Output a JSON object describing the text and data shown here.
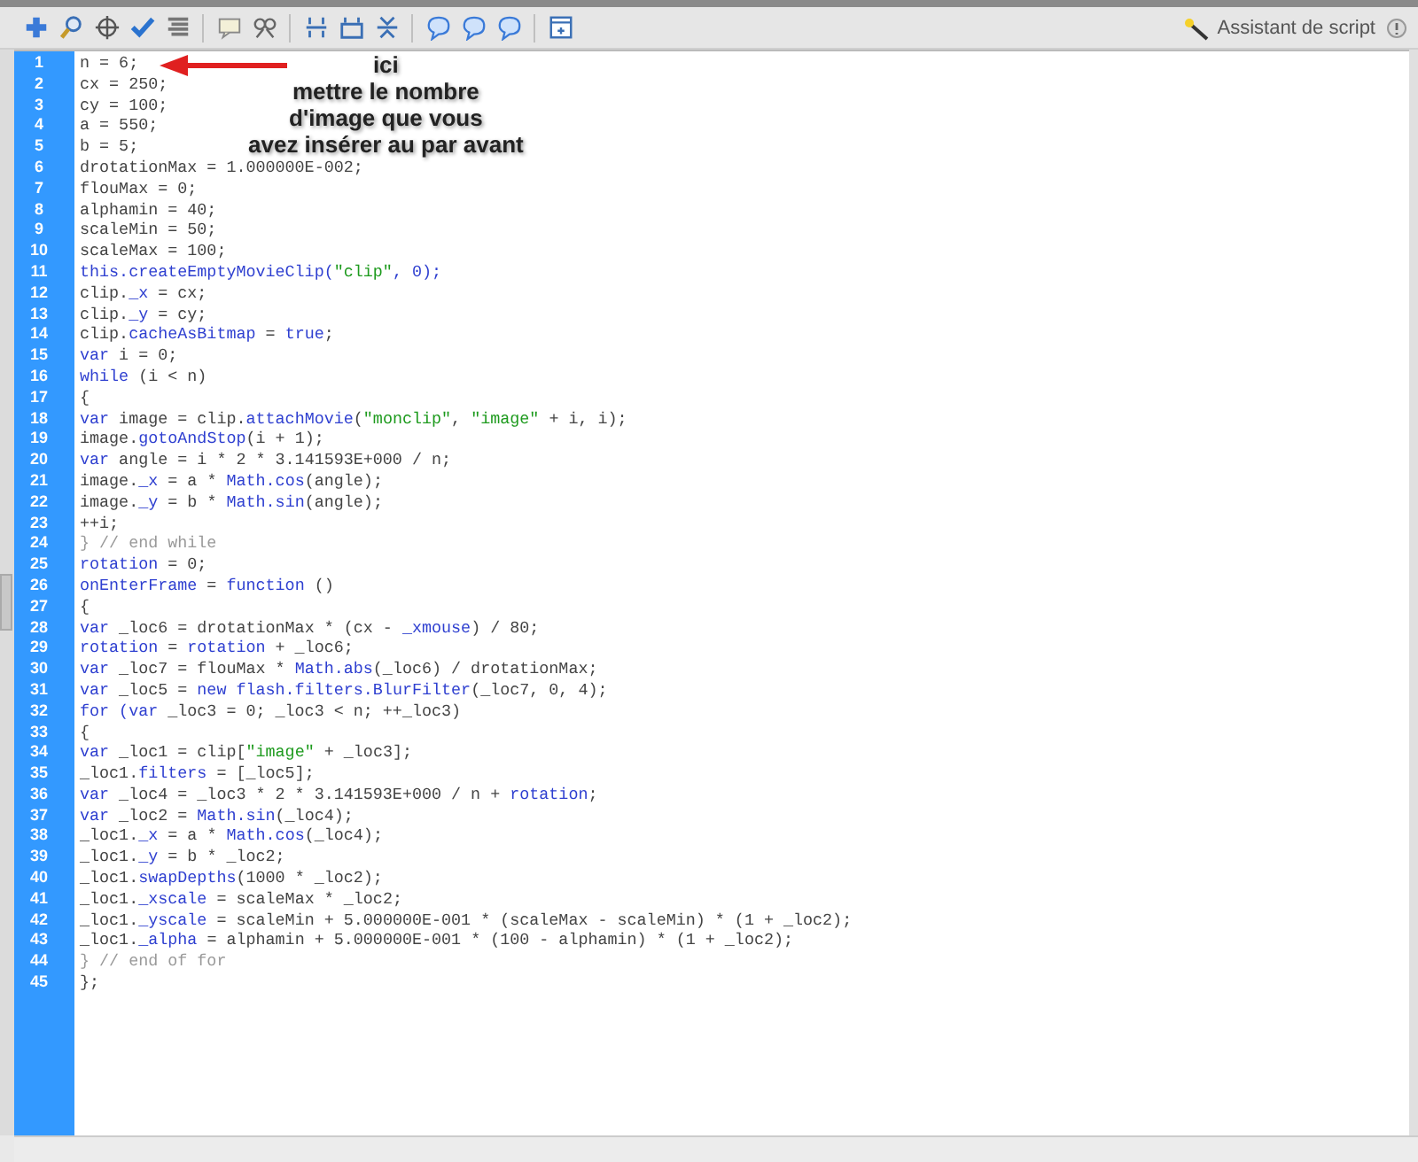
{
  "toolbar": {
    "assistant": {
      "label": "Assistant de script"
    }
  },
  "annotation": {
    "lines": [
      "ici",
      "mettre le nombre",
      "d'image que vous",
      "avez insérer au par avant"
    ]
  },
  "code": [
    {
      "number": "1",
      "tokens": [
        {
          "kind": "plain",
          "text": "n = 6;"
        }
      ]
    },
    {
      "number": "2",
      "tokens": [
        {
          "kind": "plain",
          "text": "cx = 250;"
        }
      ]
    },
    {
      "number": "3",
      "tokens": [
        {
          "kind": "plain",
          "text": "cy = 100;"
        }
      ]
    },
    {
      "number": "4",
      "tokens": [
        {
          "kind": "plain",
          "text": "a = 550;"
        }
      ]
    },
    {
      "number": "5",
      "tokens": [
        {
          "kind": "plain",
          "text": "b = 5;"
        }
      ]
    },
    {
      "number": "6",
      "tokens": [
        {
          "kind": "plain",
          "text": "drotationMax = 1.000000E-002;"
        }
      ]
    },
    {
      "number": "7",
      "tokens": [
        {
          "kind": "plain",
          "text": "flouMax = 0;"
        }
      ]
    },
    {
      "number": "8",
      "tokens": [
        {
          "kind": "plain",
          "text": "alphamin = 40;"
        }
      ]
    },
    {
      "number": "9",
      "tokens": [
        {
          "kind": "plain",
          "text": "scaleMin = 50;"
        }
      ]
    },
    {
      "number": "10",
      "tokens": [
        {
          "kind": "plain",
          "text": "scaleMax = 100;"
        }
      ]
    },
    {
      "number": "11",
      "tokens": [
        {
          "kind": "keyword",
          "text": "this.createEmptyMovieClip("
        },
        {
          "kind": "string",
          "text": "\"clip\""
        },
        {
          "kind": "keyword",
          "text": ", 0);"
        }
      ]
    },
    {
      "number": "12",
      "tokens": [
        {
          "kind": "plain",
          "text": "clip."
        },
        {
          "kind": "keyword",
          "text": "_x"
        },
        {
          "kind": "plain",
          "text": " = cx;"
        }
      ]
    },
    {
      "number": "13",
      "tokens": [
        {
          "kind": "plain",
          "text": "clip."
        },
        {
          "kind": "keyword",
          "text": "_y"
        },
        {
          "kind": "plain",
          "text": " = cy;"
        }
      ]
    },
    {
      "number": "14",
      "tokens": [
        {
          "kind": "plain",
          "text": "clip."
        },
        {
          "kind": "keyword",
          "text": "cacheAsBitmap"
        },
        {
          "kind": "plain",
          "text": " = "
        },
        {
          "kind": "keyword",
          "text": "true"
        },
        {
          "kind": "plain",
          "text": ";"
        }
      ]
    },
    {
      "number": "15",
      "tokens": [
        {
          "kind": "keyword",
          "text": "var"
        },
        {
          "kind": "plain",
          "text": " i = 0;"
        }
      ]
    },
    {
      "number": "16",
      "tokens": [
        {
          "kind": "keyword",
          "text": "while"
        },
        {
          "kind": "plain",
          "text": " (i < n)"
        }
      ]
    },
    {
      "number": "17",
      "tokens": [
        {
          "kind": "plain",
          "text": "{"
        }
      ]
    },
    {
      "number": "18",
      "tokens": [
        {
          "kind": "keyword",
          "text": "var"
        },
        {
          "kind": "plain",
          "text": " image = clip."
        },
        {
          "kind": "keyword",
          "text": "attachMovie"
        },
        {
          "kind": "plain",
          "text": "("
        },
        {
          "kind": "string",
          "text": "\"monclip\""
        },
        {
          "kind": "plain",
          "text": ", "
        },
        {
          "kind": "string",
          "text": "\"image\""
        },
        {
          "kind": "plain",
          "text": " + i, i);"
        }
      ]
    },
    {
      "number": "19",
      "tokens": [
        {
          "kind": "plain",
          "text": "image."
        },
        {
          "kind": "keyword",
          "text": "gotoAndStop"
        },
        {
          "kind": "plain",
          "text": "(i + 1);"
        }
      ]
    },
    {
      "number": "20",
      "tokens": [
        {
          "kind": "keyword",
          "text": "var"
        },
        {
          "kind": "plain",
          "text": " angle = i * 2 * 3.141593E+000 / n;"
        }
      ]
    },
    {
      "number": "21",
      "tokens": [
        {
          "kind": "plain",
          "text": "image."
        },
        {
          "kind": "keyword",
          "text": "_x"
        },
        {
          "kind": "plain",
          "text": " = a * "
        },
        {
          "kind": "keyword",
          "text": "Math.cos"
        },
        {
          "kind": "plain",
          "text": "(angle);"
        }
      ]
    },
    {
      "number": "22",
      "tokens": [
        {
          "kind": "plain",
          "text": "image."
        },
        {
          "kind": "keyword",
          "text": "_y"
        },
        {
          "kind": "plain",
          "text": " = b * "
        },
        {
          "kind": "keyword",
          "text": "Math.sin"
        },
        {
          "kind": "plain",
          "text": "(angle);"
        }
      ]
    },
    {
      "number": "23",
      "tokens": [
        {
          "kind": "plain",
          "text": "++i;"
        }
      ]
    },
    {
      "number": "24",
      "tokens": [
        {
          "kind": "comment",
          "text": "} // end while"
        }
      ]
    },
    {
      "number": "25",
      "tokens": [
        {
          "kind": "keyword",
          "text": "rotation"
        },
        {
          "kind": "plain",
          "text": " = 0;"
        }
      ]
    },
    {
      "number": "26",
      "tokens": [
        {
          "kind": "keyword",
          "text": "onEnterFrame"
        },
        {
          "kind": "plain",
          "text": " = "
        },
        {
          "kind": "keyword",
          "text": "function"
        },
        {
          "kind": "plain",
          "text": " ()"
        }
      ]
    },
    {
      "number": "27",
      "tokens": [
        {
          "kind": "plain",
          "text": "{"
        }
      ]
    },
    {
      "number": "28",
      "tokens": [
        {
          "kind": "keyword",
          "text": "var"
        },
        {
          "kind": "plain",
          "text": " _loc6 = drotationMax * (cx - "
        },
        {
          "kind": "keyword",
          "text": "_xmouse"
        },
        {
          "kind": "plain",
          "text": ") / 80;"
        }
      ]
    },
    {
      "number": "29",
      "tokens": [
        {
          "kind": "keyword",
          "text": "rotation"
        },
        {
          "kind": "plain",
          "text": " = "
        },
        {
          "kind": "keyword",
          "text": "rotation"
        },
        {
          "kind": "plain",
          "text": " + _loc6;"
        }
      ]
    },
    {
      "number": "30",
      "tokens": [
        {
          "kind": "keyword",
          "text": "var"
        },
        {
          "kind": "plain",
          "text": " _loc7 = flouMax * "
        },
        {
          "kind": "keyword",
          "text": "Math.abs"
        },
        {
          "kind": "plain",
          "text": "(_loc6) / drotationMax;"
        }
      ]
    },
    {
      "number": "31",
      "tokens": [
        {
          "kind": "keyword",
          "text": "var"
        },
        {
          "kind": "plain",
          "text": " _loc5 = "
        },
        {
          "kind": "keyword",
          "text": "new flash.filters.BlurFilter"
        },
        {
          "kind": "plain",
          "text": "(_loc7, 0, 4);"
        }
      ]
    },
    {
      "number": "32",
      "tokens": [
        {
          "kind": "keyword",
          "text": "for (var"
        },
        {
          "kind": "plain",
          "text": " _loc3 = 0; _loc3 < n; ++_loc3)"
        }
      ]
    },
    {
      "number": "33",
      "tokens": [
        {
          "kind": "plain",
          "text": "{"
        }
      ]
    },
    {
      "number": "34",
      "tokens": [
        {
          "kind": "keyword",
          "text": "var"
        },
        {
          "kind": "plain",
          "text": " _loc1 = clip["
        },
        {
          "kind": "string",
          "text": "\"image\""
        },
        {
          "kind": "plain",
          "text": " + _loc3];"
        }
      ]
    },
    {
      "number": "35",
      "tokens": [
        {
          "kind": "plain",
          "text": "_loc1."
        },
        {
          "kind": "keyword",
          "text": "filters"
        },
        {
          "kind": "plain",
          "text": " = [_loc5];"
        }
      ]
    },
    {
      "number": "36",
      "tokens": [
        {
          "kind": "keyword",
          "text": "var"
        },
        {
          "kind": "plain",
          "text": " _loc4 = _loc3 * 2 * 3.141593E+000 / n + "
        },
        {
          "kind": "keyword",
          "text": "rotation"
        },
        {
          "kind": "plain",
          "text": ";"
        }
      ]
    },
    {
      "number": "37",
      "tokens": [
        {
          "kind": "keyword",
          "text": "var"
        },
        {
          "kind": "plain",
          "text": " _loc2 = "
        },
        {
          "kind": "keyword",
          "text": "Math.sin"
        },
        {
          "kind": "plain",
          "text": "(_loc4);"
        }
      ]
    },
    {
      "number": "38",
      "tokens": [
        {
          "kind": "plain",
          "text": "_loc1."
        },
        {
          "kind": "keyword",
          "text": "_x"
        },
        {
          "kind": "plain",
          "text": " = a * "
        },
        {
          "kind": "keyword",
          "text": "Math.cos"
        },
        {
          "kind": "plain",
          "text": "(_loc4);"
        }
      ]
    },
    {
      "number": "39",
      "tokens": [
        {
          "kind": "plain",
          "text": "_loc1."
        },
        {
          "kind": "keyword",
          "text": "_y"
        },
        {
          "kind": "plain",
          "text": " = b * _loc2;"
        }
      ]
    },
    {
      "number": "40",
      "tokens": [
        {
          "kind": "plain",
          "text": "_loc1."
        },
        {
          "kind": "keyword",
          "text": "swapDepths"
        },
        {
          "kind": "plain",
          "text": "(1000 * _loc2);"
        }
      ]
    },
    {
      "number": "41",
      "tokens": [
        {
          "kind": "plain",
          "text": "_loc1."
        },
        {
          "kind": "keyword",
          "text": "_xscale"
        },
        {
          "kind": "plain",
          "text": " = scaleMax * _loc2;"
        }
      ]
    },
    {
      "number": "42",
      "tokens": [
        {
          "kind": "plain",
          "text": "_loc1."
        },
        {
          "kind": "keyword",
          "text": "_yscale"
        },
        {
          "kind": "plain",
          "text": " = scaleMin + 5.000000E-001 * (scaleMax - scaleMin) * (1 + _loc2);"
        }
      ]
    },
    {
      "number": "43",
      "tokens": [
        {
          "kind": "plain",
          "text": "_loc1."
        },
        {
          "kind": "keyword",
          "text": "_alpha"
        },
        {
          "kind": "plain",
          "text": " = alphamin + 5.000000E-001 * (100 - alphamin) * (1 + _loc2);"
        }
      ]
    },
    {
      "number": "44",
      "tokens": [
        {
          "kind": "comment",
          "text": "} // end of for"
        }
      ]
    },
    {
      "number": "45",
      "tokens": [
        {
          "kind": "plain",
          "text": "};"
        }
      ]
    }
  ]
}
